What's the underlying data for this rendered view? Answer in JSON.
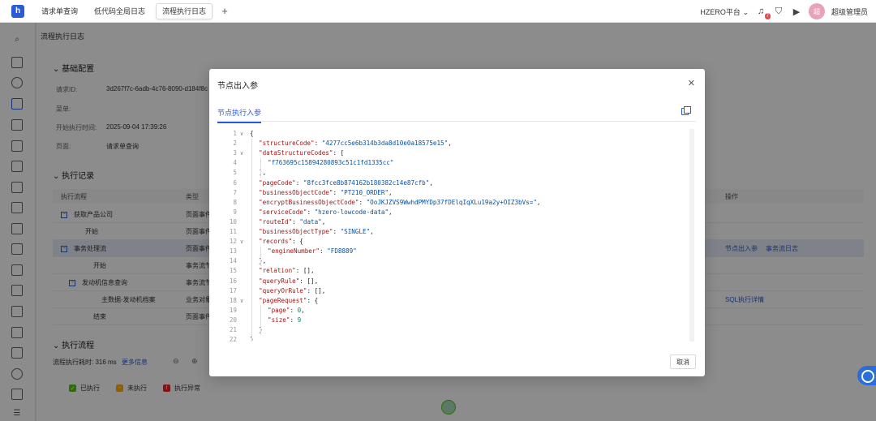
{
  "tabs": [
    {
      "label": "请求单查询",
      "active": false
    },
    {
      "label": "低代码全局日志",
      "active": false
    },
    {
      "label": "流程执行日志",
      "active": true
    }
  ],
  "header": {
    "platform": "HZERO平台",
    "notification_count": "7",
    "avatar_text": "超",
    "username": "超级管理员"
  },
  "page": {
    "title": "流程执行日志",
    "basic_section": "基础配置",
    "fields": [
      {
        "label": "请求ID:",
        "value": "3d267f7c-6adb-4c76-8090-d184f8c"
      },
      {
        "label": "菜单:",
        "value": ""
      },
      {
        "label": "开始执行时间:",
        "value": "2025-09-04 17:39:26"
      },
      {
        "label": "页面:",
        "value": "请求单查询"
      }
    ],
    "exec_section": "执行记录",
    "columns": {
      "flow": "执行流程",
      "type": "类型",
      "ops": "操作"
    },
    "rows": [
      {
        "name": "获取产品公司",
        "type": "页面事件",
        "expander": "−",
        "ops": []
      },
      {
        "name": "开始",
        "type": "页面事件",
        "expander": "",
        "ops": []
      },
      {
        "name": "事务处理流",
        "type": "页面事件",
        "expander": "−",
        "ops": [
          "节点出入参",
          "事务流日志"
        ]
      },
      {
        "name": "开始",
        "type": "事务流节",
        "expander": "",
        "ops": []
      },
      {
        "name": "发动机信息查询",
        "type": "事务流节",
        "expander": "−",
        "ops": []
      },
      {
        "name": "主数据-发动机档案",
        "type": "业务对象",
        "expander": "",
        "ops": [
          "SQL执行详情"
        ]
      },
      {
        "name": "结束",
        "type": "页面事件",
        "expander": "",
        "ops": []
      }
    ],
    "flow_section": "执行流程",
    "flow_time": "流程执行耗时: 316 ms",
    "more_info": "更多信息",
    "legend": [
      {
        "label": "已执行",
        "color": "#52c41a",
        "mark": "✓"
      },
      {
        "label": "未执行",
        "color": "#faad14",
        "mark": "−"
      },
      {
        "label": "执行异常",
        "color": "#f5222d",
        "mark": "!"
      }
    ]
  },
  "modal": {
    "title": "节点出入参",
    "tab": "节点执行入参",
    "cancel": "取消",
    "lines": [
      {
        "n": "1",
        "fold": "∨",
        "indent": 0,
        "parts": [
          [
            "p",
            "{"
          ]
        ]
      },
      {
        "n": "2",
        "fold": "",
        "indent": 1,
        "parts": [
          [
            "k",
            "\"structureCode\""
          ],
          [
            "p",
            ": "
          ],
          [
            "s",
            "\"4277cc5e6b314b3da8d10e0a18575e15\""
          ],
          [
            "p",
            ","
          ]
        ]
      },
      {
        "n": "3",
        "fold": "∨",
        "indent": 1,
        "parts": [
          [
            "k",
            "\"dataStructureCodes\""
          ],
          [
            "p",
            ": ["
          ]
        ]
      },
      {
        "n": "4",
        "fold": "",
        "indent": 2,
        "parts": [
          [
            "s",
            "\"f763695c15894280893c51c1fd1335cc\""
          ]
        ]
      },
      {
        "n": "5",
        "fold": "",
        "indent": 1,
        "parts": [
          [
            "p",
            "],"
          ]
        ]
      },
      {
        "n": "6",
        "fold": "",
        "indent": 1,
        "parts": [
          [
            "k",
            "\"pageCode\""
          ],
          [
            "p",
            ": "
          ],
          [
            "s",
            "\"8fcc3fce8b874162b180382c14e87cfb\""
          ],
          [
            "p",
            ","
          ]
        ]
      },
      {
        "n": "7",
        "fold": "",
        "indent": 1,
        "parts": [
          [
            "k",
            "\"businessObjectCode\""
          ],
          [
            "p",
            ": "
          ],
          [
            "s",
            "\"PT210_ORDER\""
          ],
          [
            "p",
            ","
          ]
        ]
      },
      {
        "n": "8",
        "fold": "",
        "indent": 1,
        "parts": [
          [
            "k",
            "\"encryptBusinessObjectCode\""
          ],
          [
            "p",
            ": "
          ],
          [
            "s",
            "\"OoJKJZVS9WwhdPMYDp37fDElqIqXLu19a2y+OIZ3bVs=\""
          ],
          [
            "p",
            ","
          ]
        ]
      },
      {
        "n": "9",
        "fold": "",
        "indent": 1,
        "parts": [
          [
            "k",
            "\"serviceCode\""
          ],
          [
            "p",
            ": "
          ],
          [
            "s",
            "\"hzero-lowcode-data\""
          ],
          [
            "p",
            ","
          ]
        ]
      },
      {
        "n": "10",
        "fold": "",
        "indent": 1,
        "parts": [
          [
            "k",
            "\"routeId\""
          ],
          [
            "p",
            ": "
          ],
          [
            "s",
            "\"data\""
          ],
          [
            "p",
            ","
          ]
        ]
      },
      {
        "n": "11",
        "fold": "",
        "indent": 1,
        "parts": [
          [
            "k",
            "\"businessObjectType\""
          ],
          [
            "p",
            ": "
          ],
          [
            "s",
            "\"SINGLE\""
          ],
          [
            "p",
            ","
          ]
        ]
      },
      {
        "n": "12",
        "fold": "∨",
        "indent": 1,
        "parts": [
          [
            "k",
            "\"records\""
          ],
          [
            "p",
            ": {"
          ]
        ]
      },
      {
        "n": "13",
        "fold": "",
        "indent": 2,
        "parts": [
          [
            "k",
            "\"engineNumber\""
          ],
          [
            "p",
            ": "
          ],
          [
            "s",
            "\"FD8889\""
          ]
        ]
      },
      {
        "n": "14",
        "fold": "",
        "indent": 1,
        "parts": [
          [
            "p",
            "},"
          ]
        ]
      },
      {
        "n": "15",
        "fold": "",
        "indent": 1,
        "parts": [
          [
            "k",
            "\"relation\""
          ],
          [
            "p",
            ": [],"
          ]
        ]
      },
      {
        "n": "16",
        "fold": "",
        "indent": 1,
        "parts": [
          [
            "k",
            "\"queryRule\""
          ],
          [
            "p",
            ": [],"
          ]
        ]
      },
      {
        "n": "17",
        "fold": "",
        "indent": 1,
        "parts": [
          [
            "k",
            "\"queryOrRule\""
          ],
          [
            "p",
            ": [],"
          ]
        ]
      },
      {
        "n": "18",
        "fold": "∨",
        "indent": 1,
        "parts": [
          [
            "k",
            "\"pageRequest\""
          ],
          [
            "p",
            ": {"
          ]
        ]
      },
      {
        "n": "19",
        "fold": "",
        "indent": 2,
        "parts": [
          [
            "k",
            "\"page\""
          ],
          [
            "p",
            ": "
          ],
          [
            "n",
            "0"
          ],
          [
            "p",
            ","
          ]
        ]
      },
      {
        "n": "20",
        "fold": "",
        "indent": 2,
        "parts": [
          [
            "k",
            "\"size\""
          ],
          [
            "p",
            ": "
          ],
          [
            "n",
            "9"
          ]
        ]
      },
      {
        "n": "21",
        "fold": "",
        "indent": 1,
        "parts": [
          [
            "p",
            "}"
          ]
        ]
      },
      {
        "n": "22",
        "fold": "",
        "indent": 0,
        "parts": [
          [
            "p",
            "}"
          ]
        ]
      }
    ]
  }
}
